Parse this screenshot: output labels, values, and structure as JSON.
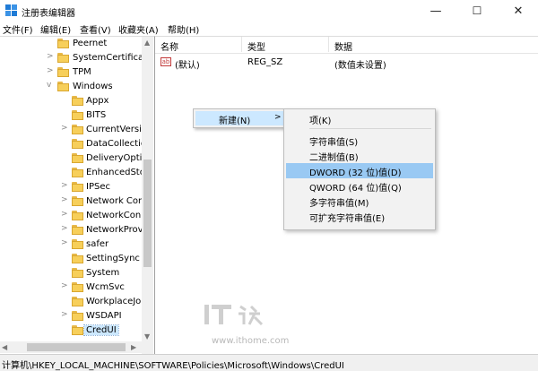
{
  "window": {
    "title": "注册表编辑器",
    "controls": {
      "minimize": "—",
      "maximize": "☐",
      "close": "✕"
    }
  },
  "menu": [
    "文件(F)",
    "编辑(E)",
    "查看(V)",
    "收藏夹(A)",
    "帮助(H)"
  ],
  "tree": {
    "items": [
      {
        "label": "Peernet",
        "expand": ""
      },
      {
        "label": "SystemCertificate",
        "expand": ">"
      },
      {
        "label": "TPM",
        "expand": ">"
      },
      {
        "label": "Windows",
        "expand": "v"
      },
      {
        "label": "Appx",
        "expand": ""
      },
      {
        "label": "BITS",
        "expand": ""
      },
      {
        "label": "CurrentVersic",
        "expand": ">"
      },
      {
        "label": "DataCollection",
        "expand": ""
      },
      {
        "label": "DeliveryOptin",
        "expand": ""
      },
      {
        "label": "EnhancedStor",
        "expand": ""
      },
      {
        "label": "IPSec",
        "expand": ">"
      },
      {
        "label": "Network Con",
        "expand": ">"
      },
      {
        "label": "NetworkConr",
        "expand": ">"
      },
      {
        "label": "NetworkProv",
        "expand": ">"
      },
      {
        "label": "safer",
        "expand": ">"
      },
      {
        "label": "SettingSync",
        "expand": ""
      },
      {
        "label": "System",
        "expand": ""
      },
      {
        "label": "WcmSvc",
        "expand": ">"
      },
      {
        "label": "WorkplaceJo",
        "expand": ""
      },
      {
        "label": "WSDAPI",
        "expand": ">"
      },
      {
        "label": "CredUI",
        "expand": ""
      }
    ]
  },
  "list": {
    "columns": [
      "名称",
      "类型",
      "数据"
    ],
    "rows": [
      {
        "icon": "ab",
        "name": "(默认)",
        "type": "REG_SZ",
        "data": "(数值未设置)"
      }
    ]
  },
  "context_menu": {
    "new_label": "新建(N)",
    "new_arrow": ">",
    "submenu": [
      "项(K)",
      "字符串值(S)",
      "二进制值(B)",
      "DWORD (32 位)值(D)",
      "QWORD (64 位)值(Q)",
      "多字符串值(M)",
      "可扩充字符串值(E)"
    ],
    "highlighted_index": 3
  },
  "status": {
    "path": "计算机\\HKEY_LOCAL_MACHINE\\SOFTWARE\\Policies\\Microsoft\\Windows\\CredUI"
  },
  "watermark": {
    "logo": "IT之家",
    "url": "www.ithome.com"
  },
  "colors": {
    "highlight": "#99c9f3",
    "hover": "#cce8ff",
    "folder": "#f7cf5a",
    "app_icon": "#1f7bd6"
  }
}
